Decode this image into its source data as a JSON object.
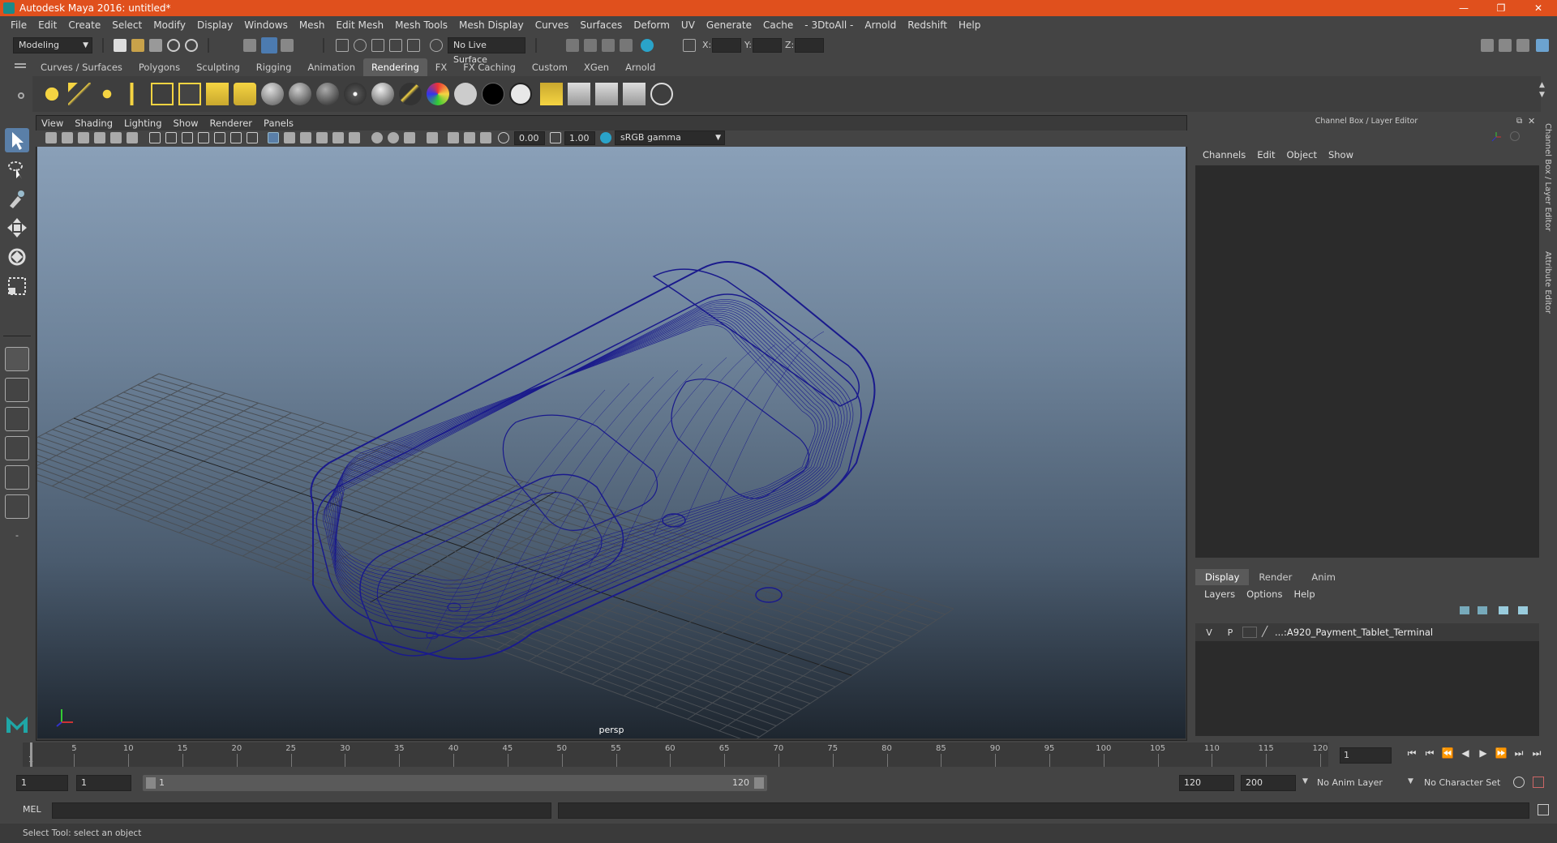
{
  "window": {
    "title": "Autodesk Maya 2016: untitled*",
    "controls": [
      "—",
      "❐",
      "✕"
    ]
  },
  "menubar": [
    "File",
    "Edit",
    "Create",
    "Select",
    "Modify",
    "Display",
    "Windows",
    "Mesh",
    "Edit Mesh",
    "Mesh Tools",
    "Mesh Display",
    "Curves",
    "Surfaces",
    "Deform",
    "UV",
    "Generate",
    "Cache",
    "- 3DtoAll -",
    "Arnold",
    "Redshift",
    "Help"
  ],
  "statusline": {
    "mode": "Modeling",
    "live_surface": "No Live Surface",
    "x_label": "X:",
    "y_label": "Y:",
    "z_label": "Z:"
  },
  "shelf": {
    "tabs": [
      "Curves / Surfaces",
      "Polygons",
      "Sculpting",
      "Rigging",
      "Animation",
      "Rendering",
      "FX",
      "FX Caching",
      "Custom",
      "XGen",
      "Arnold"
    ],
    "active_tab": "Rendering"
  },
  "viewport": {
    "menu": [
      "View",
      "Shading",
      "Lighting",
      "Show",
      "Renderer",
      "Panels"
    ],
    "exposure": "0.00",
    "gamma": "1.00",
    "color_space": "sRGB gamma",
    "camera": "persp",
    "model_color": "#1a1a8c"
  },
  "channel_box": {
    "title": "Channel Box / Layer Editor",
    "menu": [
      "Channels",
      "Edit",
      "Object",
      "Show"
    ]
  },
  "layer_editor": {
    "tabs": [
      "Display",
      "Render",
      "Anim"
    ],
    "active_tab": "Display",
    "menu": [
      "Layers",
      "Options",
      "Help"
    ],
    "layer": {
      "v": "V",
      "p": "P",
      "name": "...:A920_Payment_Tablet_Terminal"
    }
  },
  "side_tabs": [
    "Channel Box / Layer Editor",
    "Attribute Editor"
  ],
  "timeline": {
    "ticks": [
      "5",
      "10",
      "15",
      "20",
      "25",
      "30",
      "35",
      "40",
      "45",
      "50",
      "55",
      "60",
      "65",
      "70",
      "75",
      "80",
      "85",
      "90",
      "95",
      "100",
      "105",
      "110",
      "115",
      "120"
    ],
    "first": "1",
    "current_frame": "1",
    "playback_icons": [
      "⏮",
      "⏮",
      "⏪",
      "◀",
      "▶",
      "⏩",
      "⏭",
      "⏭"
    ]
  },
  "range": {
    "start": "1",
    "anim_start": "1",
    "slider_start": "1",
    "slider_end": "120",
    "anim_end": "120",
    "end": "200",
    "anim_layer": "No Anim Layer",
    "character_set": "No Character Set"
  },
  "cmdline": {
    "label": "MEL"
  },
  "helpline": {
    "text": "Select Tool: select an object"
  }
}
